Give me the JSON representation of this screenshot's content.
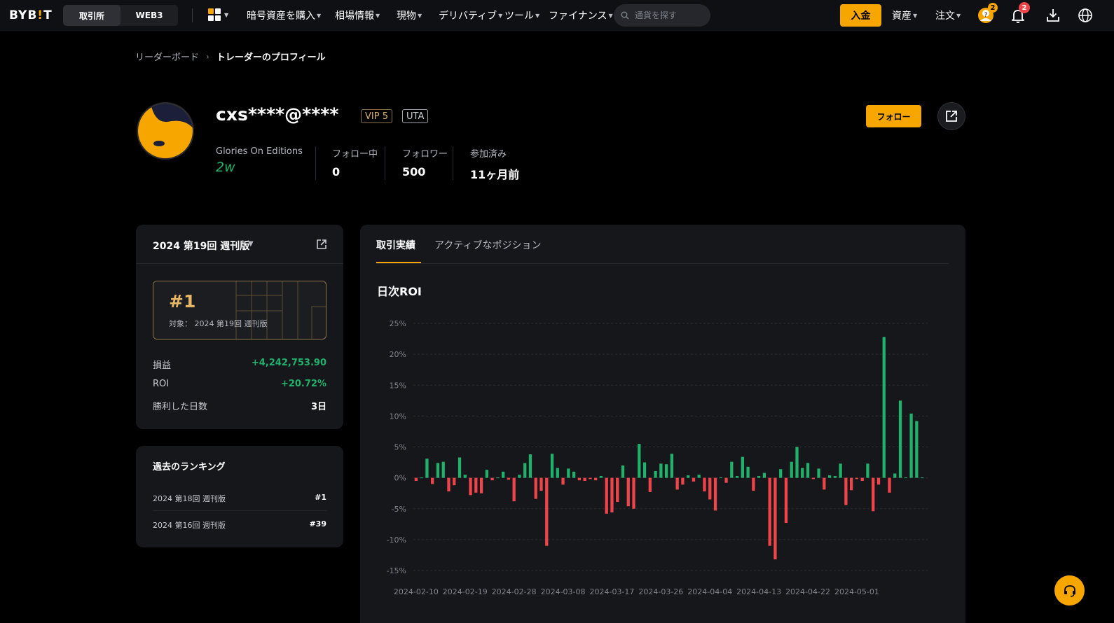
{
  "nav": {
    "logo": "BYBIT",
    "segments": [
      "取引所",
      "WEB3"
    ],
    "menus": [
      "暗号資産を購入",
      "相場情報",
      "現物",
      "デリバティブ",
      "ツール",
      "ファイナンス"
    ],
    "search_placeholder": "通貨を探す",
    "deposit_label": "入金",
    "right_menus": [
      "資産",
      "注文"
    ],
    "help_badge": "2",
    "notify_badge": "2"
  },
  "breadcrumb": {
    "parent": "リーダーボード",
    "current": "トレーダーのプロフィール"
  },
  "profile": {
    "username": "cxs****@****",
    "tags": [
      "VIP 5",
      "UTA"
    ],
    "emblem_label": "Glories On Editions",
    "emblem_value": "2w",
    "stats": [
      {
        "label": "フォロー中",
        "value": "0"
      },
      {
        "label": "フォロワー",
        "value": "500"
      },
      {
        "label": "参加済み",
        "value": "11ヶ月前"
      }
    ],
    "follow_label": "フォロー"
  },
  "weekly": {
    "title": "2024 第19回 週刊版",
    "rank": "#1",
    "rank_sub": "対象： 2024 第19回 週刊版",
    "rows": [
      {
        "label": "損益",
        "value": "+4,242,753.90"
      },
      {
        "label": "ROI",
        "value": "+20.72%"
      },
      {
        "label": "勝利した日数",
        "value": "3日"
      }
    ]
  },
  "history": {
    "title": "過去のランキング",
    "items": [
      {
        "label": "2024 第18回 週刊版",
        "rank": "#1"
      },
      {
        "label": "2024 第16回 週刊版",
        "rank": "#39"
      }
    ]
  },
  "main": {
    "tabs": [
      "取引実績",
      "アクティブなポジション"
    ],
    "chart_title": "日次ROI"
  },
  "colors": {
    "accent": "#f7a600",
    "up": "#20b26c",
    "down": "#ef454a",
    "card": "#16171b"
  },
  "chart_data": {
    "type": "bar",
    "title": "日次ROI",
    "xlabel": "",
    "ylabel": "",
    "ylim": [
      -15,
      25
    ],
    "yticks": [
      "25%",
      "20%",
      "15%",
      "10%",
      "5%",
      "0%",
      "-5%",
      "-10%",
      "-15%"
    ],
    "ytick_values": [
      25,
      20,
      15,
      10,
      5,
      0,
      -5,
      -10,
      -15
    ],
    "xtick_labels": [
      "2024-02-10",
      "2024-02-19",
      "2024-02-28",
      "2024-03-08",
      "2024-03-17",
      "2024-03-26",
      "2024-04-04",
      "2024-04-13",
      "2024-04-22",
      "2024-05-01"
    ],
    "start_date": "2024-02-10",
    "series": [
      {
        "values": [
          -0.5,
          0,
          3.1,
          -1.0,
          2.4,
          2.6,
          -2.2,
          -1.2,
          3.3,
          0.5,
          -2.8,
          -2.4,
          -2.5,
          1.3,
          -0.4,
          0,
          1.0,
          -0.3,
          -3.8,
          0.5,
          2.4,
          3.8,
          -3.4,
          -2.1,
          -11,
          3.9,
          1.6,
          -1.1,
          1.5,
          1.0,
          -0.4,
          -0.5,
          -0.2,
          -0.4,
          0.3,
          -5.8,
          -5.6,
          -3.9,
          2.0,
          -4.6,
          -5.0,
          5.5,
          2.5,
          -2.3,
          1.1,
          2.3,
          2.2,
          3.9,
          -1.9,
          -1.1,
          0.4,
          -0.6,
          0.5,
          -2.2,
          -3.5,
          -5.3,
          0,
          -0.8,
          2.6,
          0.3,
          3.4,
          1.8,
          -2.1,
          0.3,
          0.8,
          -11,
          -13.2,
          1.4,
          -7.3,
          2.6,
          5.0,
          1.6,
          2.4,
          -0.2,
          1.5,
          -1.9,
          0.4,
          0.3,
          2.3,
          -4.4,
          -2.0,
          -0.2,
          -0.5,
          2.3,
          -5.4,
          -1.1,
          22.8,
          -2.4,
          0.7,
          12.5,
          0,
          10.4,
          9.2,
          0
        ]
      }
    ]
  }
}
